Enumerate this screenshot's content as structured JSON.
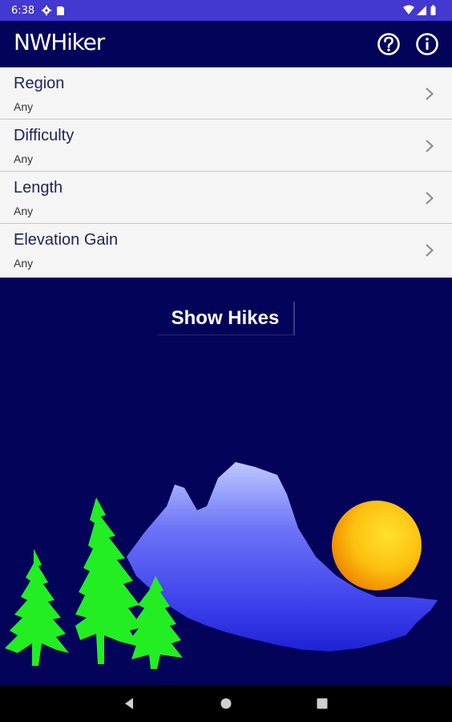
{
  "status_bar": {
    "time": "6:38"
  },
  "app_bar": {
    "title": "NWHiker"
  },
  "filters": [
    {
      "label": "Region",
      "value": "Any"
    },
    {
      "label": "Difficulty",
      "value": "Any"
    },
    {
      "label": "Length",
      "value": "Any"
    },
    {
      "label": "Elevation Gain",
      "value": "Any"
    }
  ],
  "main": {
    "show_hikes_label": "Show Hikes"
  },
  "icons": {
    "settings": "gear-icon",
    "sd_card": "sd-card-icon",
    "wifi": "wifi-icon",
    "signal": "signal-icon",
    "battery": "battery-icon",
    "help": "help-icon",
    "info": "info-icon",
    "chevron": "chevron-right-icon",
    "back": "back-icon",
    "home": "home-icon",
    "recents": "recents-icon"
  },
  "colors": {
    "status_bar": "#4338cf",
    "app_bar": "#03035a",
    "list_background": "#f5f5f5",
    "trees": "#22ee22",
    "sun": "#f5b800",
    "mountain": "#4a50f0"
  }
}
